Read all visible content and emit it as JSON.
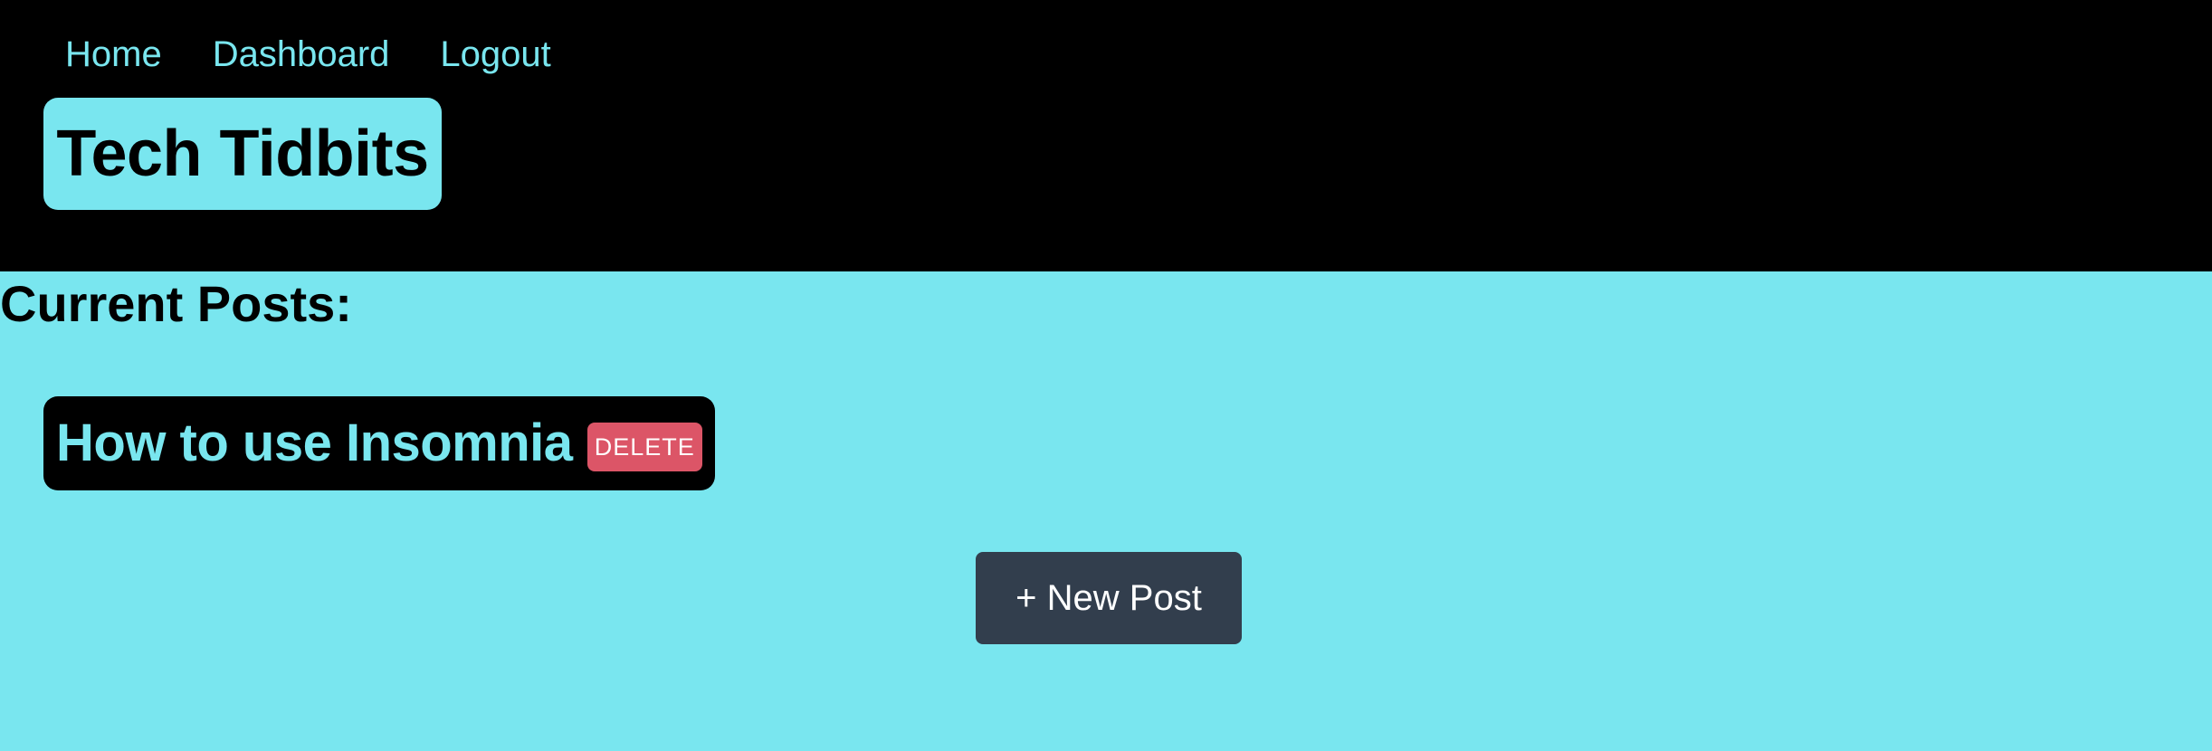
{
  "nav": {
    "items": [
      {
        "label": "Home"
      },
      {
        "label": "Dashboard"
      },
      {
        "label": "Logout"
      }
    ]
  },
  "header": {
    "title": "Tech Tidbits"
  },
  "main": {
    "section_title": "Current Posts:",
    "posts": [
      {
        "title": "How to use Insomnia",
        "delete_label": "DELETE"
      }
    ],
    "new_post_label": "+ New Post"
  },
  "colors": {
    "accent": "#79e6ef",
    "header_bg": "#000000",
    "delete": "#dc5567",
    "primary_button": "#323e4d"
  }
}
